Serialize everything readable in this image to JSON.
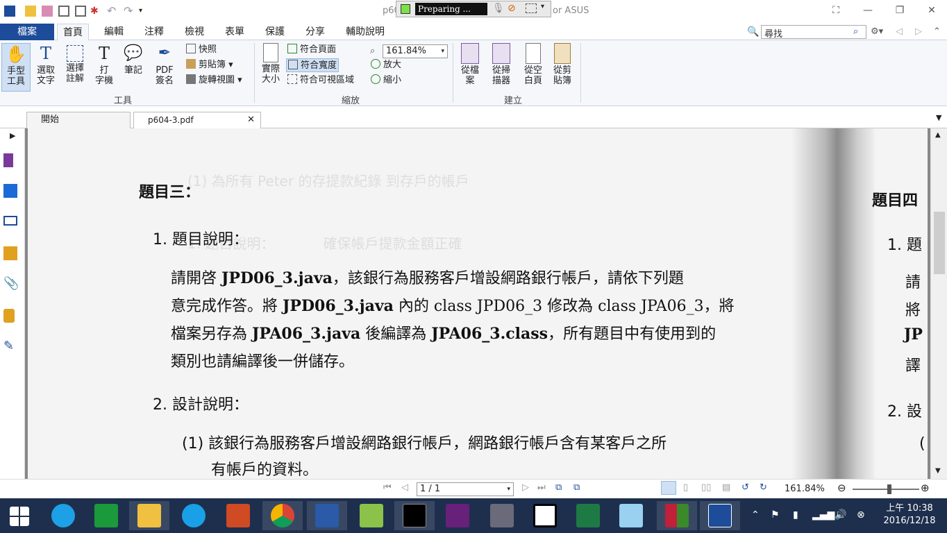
{
  "titlebar": {
    "title_left": "p60",
    "title_right": "or ASUS",
    "recording": {
      "status": "Preparing ..."
    }
  },
  "menu": {
    "file": "檔案",
    "tabs": [
      "首頁",
      "編輯",
      "注釋",
      "檢視",
      "表單",
      "保護",
      "分享",
      "輔助說明"
    ],
    "search_placeholder": "尋找"
  },
  "ribbon": {
    "tools": {
      "hand": "手型\n工具",
      "select_text": "選取\n文字",
      "select_annot": "選擇\n註解",
      "typewriter": "打\n字機",
      "note": "筆記",
      "pdf_sign": "PDF\n簽名",
      "snapshot": "快照",
      "clipboard": "剪貼簿",
      "rotate": "旋轉視圖",
      "group": "工具"
    },
    "zoom": {
      "actual": "實際\n大小",
      "fit_page": "符合頁面",
      "fit_width": "符合寬度",
      "fit_visible": "符合可視區域",
      "zoom_value": "161.84%",
      "zoom_in": "放大",
      "zoom_out": "縮小",
      "group": "縮放"
    },
    "create": {
      "from_file": "從檔\n案",
      "from_scanner": "從掃\n描器",
      "from_blank": "從空\n白頁",
      "from_clip": "從剪\n貼簿",
      "group": "建立"
    }
  },
  "doc_tabs": [
    {
      "label": "開始"
    },
    {
      "label": "p604-3.pdf"
    }
  ],
  "page": {
    "heading": "題目三：",
    "s1_title": "1. 題目說明：",
    "p1_l1a": "請開啓 ",
    "p1_l1b": "JPD06_3.java",
    "p1_l1c": "，該銀行為服務客戶增設網路銀行帳戶，請依下列題",
    "p1_l2a": "意完成作答。將 ",
    "p1_l2b": "JPD06_3.java",
    "p1_l2c": " 內的 class JPD06_3 修改為 class JPA06_3，將",
    "p1_l3a": "檔案另存為 ",
    "p1_l3b": "JPA06_3.java",
    "p1_l3c": " 後編譯為 ",
    "p1_l3d": "JPA06_3.class",
    "p1_l3e": "，所有題目中有使用到的",
    "p1_l4": "類別也請編譯後一併儲存。",
    "s2_title": "2. 設計說明：",
    "s2_i1a": "(1) 該銀行為服務客戶增設網路銀行帳戶，網路銀行帳戶含有某客戶之所",
    "s2_i1b": "有帳戶的資料。",
    "right_heading": "題目四",
    "right_1": "1. 題",
    "right_2a": "請",
    "right_2b": "將",
    "right_2c": "JP",
    "right_2d": "譯",
    "right_3": "2. 設",
    "right_4": "("
  },
  "status": {
    "page_indicator": "1 / 1",
    "zoom": "161.84%",
    "zoom_level": 0.55
  },
  "taskbar": {
    "time": "上午 10:38",
    "date": "2016/12/18"
  }
}
